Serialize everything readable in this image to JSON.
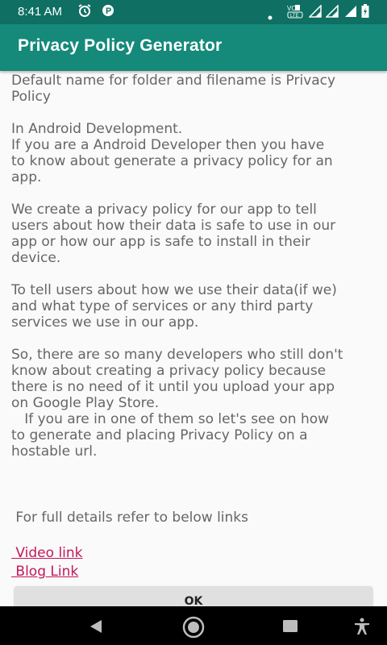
{
  "status_bar": {
    "time": "8:41 AM",
    "icons": [
      "alarm-icon",
      "p-app-icon",
      "dot-icon",
      "volte-icon",
      "signal-icon",
      "signal-icon",
      "battery-icon"
    ]
  },
  "app_bar": {
    "title": "Privacy Policy Generator"
  },
  "body_text": "Default name for folder and filename is Privacy\nPolicy\n\nIn Android Development.\nIf you are a Android Developer then you have\nto know about generate a privacy policy for an\napp.\n\nWe create a privacy policy for our app to tell\nusers about how their data is safe to use in our\napp or how our app is safe to install in their\ndevice.\n\nTo tell users about how we use their data(if we)\nand what type of services or any third party\nservices we use in our app.\n\nSo, there are so many developers who still don't\nknow about creating a privacy policy because\nthere is no need of it until you upload your app\non Google Play Store.\n   If you are in one of them so let's see on how\nto generate and placing Privacy Policy on a\nhostable url.",
  "details_text": " For full details refer to below links",
  "links": {
    "video": " Video link",
    "blog": " Blog Link"
  },
  "ok_button": {
    "label": "OK"
  },
  "nav_bar": {
    "icons": [
      "back-icon",
      "home-icon",
      "recents-icon",
      "accessibility-icon"
    ]
  },
  "colors": {
    "status_bar": "#0f6f63",
    "app_bar": "#15897a",
    "link": "#c2185b",
    "text": "#666666"
  }
}
